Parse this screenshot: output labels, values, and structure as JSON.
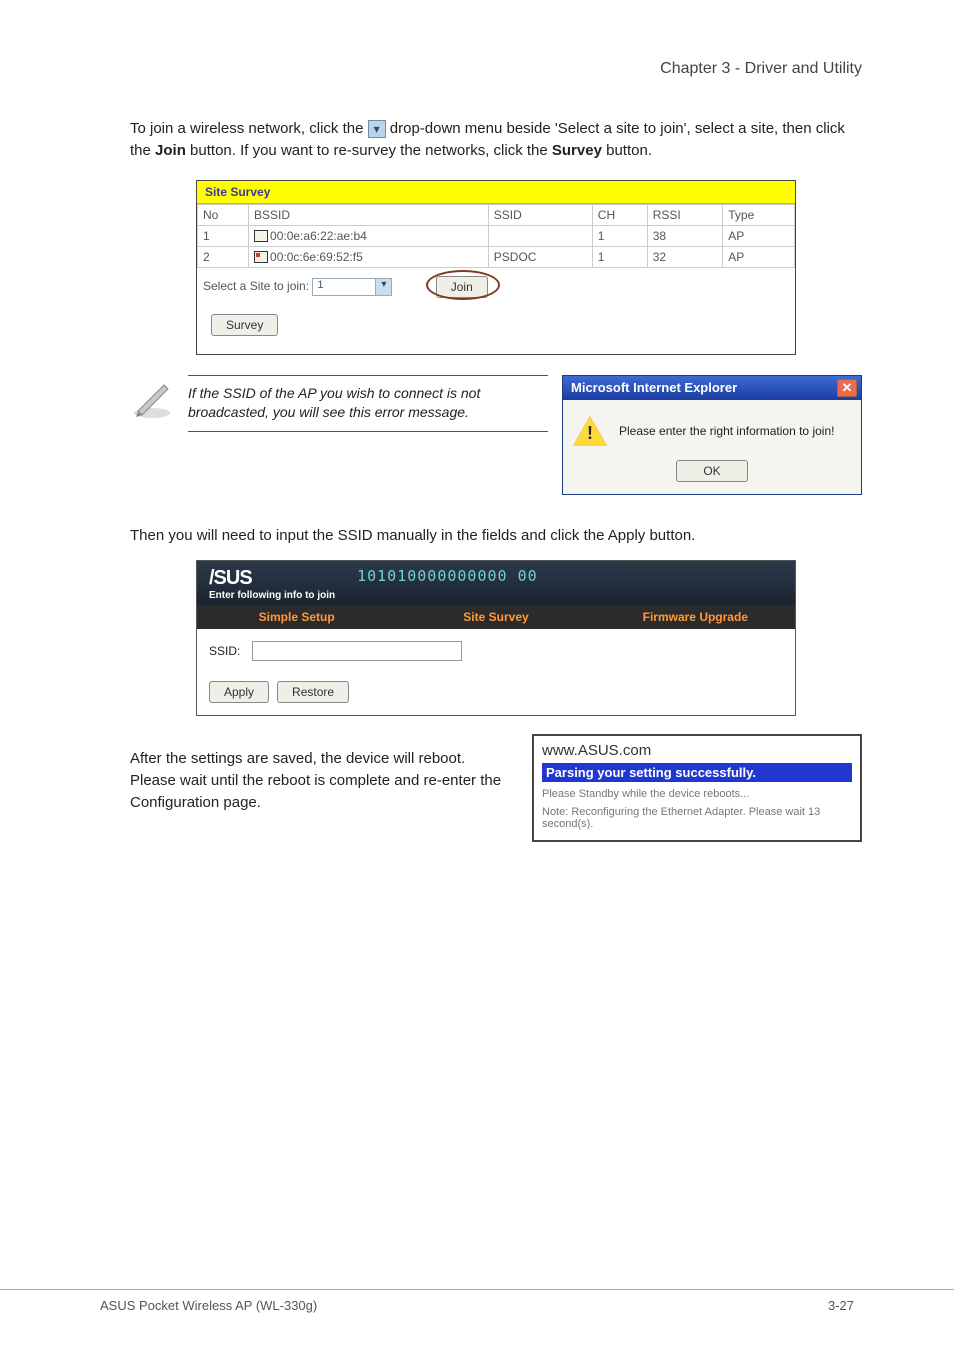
{
  "chapter_heading": "Chapter 3 - Driver and Utility",
  "intro_para_prefix": "To join a wireless network, click the ",
  "intro_para_mid": " drop-down menu beside 'Select a site to join', select a site, then click the ",
  "intro_join_bold": "Join",
  "intro_para_suffix": " button. If you want to re-survey the networks, click the ",
  "intro_survey_bold": "Survey",
  "intro_para_end": " button.",
  "survey": {
    "title": "Site Survey",
    "headers": {
      "no": "No",
      "bssid": "BSSID",
      "ssid": "SSID",
      "ch": "CH",
      "rssi": "RSSI",
      "type": "Type"
    },
    "rows": [
      {
        "no": "1",
        "bssid": "00:0e:a6:22:ae:b4",
        "ssid": "",
        "ch": "1",
        "rssi": "38",
        "type": "AP"
      },
      {
        "no": "2",
        "bssid": "00:0c:6e:69:52:f5",
        "ssid": "PSDOC",
        "ch": "1",
        "rssi": "32",
        "type": "AP"
      }
    ],
    "select_label": "Select a Site to join:",
    "select_value": "1",
    "join_btn": "Join",
    "survey_btn": "Survey"
  },
  "note_text": "If the SSID of the AP you wish to connect is not broadcasted, you will see this error message.",
  "ie": {
    "title": "Microsoft Internet Explorer",
    "body": "Please enter the right information to join!",
    "ok": "OK"
  },
  "second_para": "Then you will need to input the SSID manually in the fields and click the Apply button.",
  "asus": {
    "sub": "Enter following info to join",
    "binary": "101010000000000 00",
    "tabs": {
      "simple": "Simple Setup",
      "survey": "Site Survey",
      "fw": "Firmware Upgrade"
    },
    "ssid_label": "SSID:",
    "apply": "Apply",
    "restore": "Restore"
  },
  "reboot_para": "After the settings are saved, the device will reboot. Please wait until the reboot is complete and re-enter the Configuration page.",
  "reboot_box": {
    "url": "www.ASUS.com",
    "blue": "Parsing your setting successfully.",
    "line1": "Please Standby while the device reboots...",
    "line2": "Note: Reconfiguring the Ethernet Adapter. Please wait 13 second(s)."
  },
  "footer": {
    "left": "ASUS Pocket Wireless AP (WL-330g)",
    "right": "3-27"
  }
}
